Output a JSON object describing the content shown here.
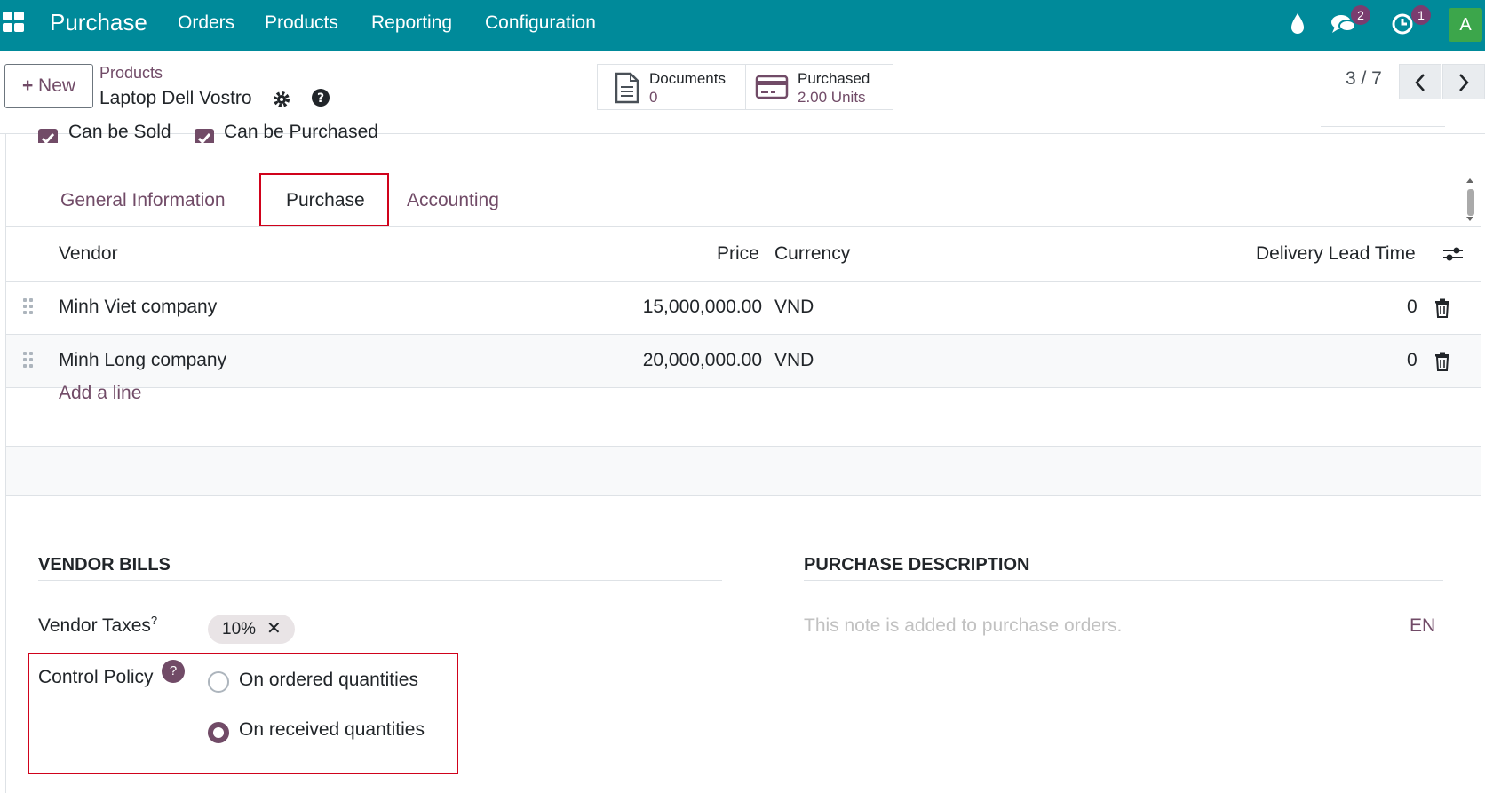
{
  "navbar": {
    "app_name": "Purchase",
    "menu": [
      "Orders",
      "Products",
      "Reporting",
      "Configuration"
    ],
    "messages_count": "2",
    "activities_count": "1",
    "avatar_initial": "A"
  },
  "controlbar": {
    "new_label": "New",
    "breadcrumb_parent": "Products",
    "record_title": "Laptop Dell Vostro",
    "smart_buttons": [
      {
        "label": "Documents",
        "value": "0",
        "icon": "document-icon"
      },
      {
        "label": "Purchased",
        "value": "2.00 Units",
        "icon": "credit-card-icon"
      }
    ],
    "pager": "3 / 7"
  },
  "sheet": {
    "checkboxes": [
      {
        "label": "Can be Sold",
        "checked": true
      },
      {
        "label": "Can be Purchased",
        "checked": true
      }
    ],
    "tabs": [
      "General Information",
      "Purchase",
      "Accounting"
    ],
    "active_tab": "Purchase",
    "vendor_table": {
      "headers": {
        "vendor": "Vendor",
        "price": "Price",
        "currency": "Currency",
        "lead_time": "Delivery Lead Time"
      },
      "rows": [
        {
          "vendor": "Minh Viet company",
          "price": "15,000,000.00",
          "currency": "VND",
          "lead_time": "0"
        },
        {
          "vendor": "Minh Long company",
          "price": "20,000,000.00",
          "currency": "VND",
          "lead_time": "0"
        }
      ],
      "add_line": "Add a line"
    },
    "vendor_bills": {
      "title": "VENDOR BILLS",
      "vendor_taxes_label": "Vendor Taxes",
      "vendor_taxes_help": "?",
      "tax_tag": "10%",
      "control_policy_label": "Control Policy",
      "control_policy_help": "?",
      "options": [
        {
          "label": "On ordered quantities",
          "selected": false
        },
        {
          "label": "On received quantities",
          "selected": true
        }
      ]
    },
    "purchase_description": {
      "title": "PURCHASE DESCRIPTION",
      "placeholder": "This note is added to purchase orders.",
      "lang": "EN"
    }
  },
  "colors": {
    "navbar": "#008A9A",
    "accent": "#714B67",
    "highlight_border": "#D0021B"
  }
}
